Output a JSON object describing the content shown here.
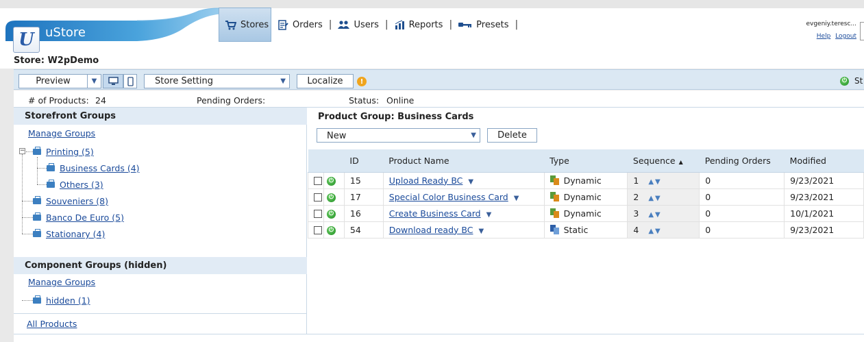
{
  "app": {
    "name": "uStore",
    "logo_letter": "U"
  },
  "nav": [
    {
      "label": "Stores",
      "icon": "cart-icon",
      "active": true
    },
    {
      "label": "Orders",
      "icon": "orders-icon",
      "active": false
    },
    {
      "label": "Users",
      "icon": "users-icon",
      "active": false
    },
    {
      "label": "Reports",
      "icon": "chart-icon",
      "active": false
    },
    {
      "label": "Presets",
      "icon": "key-icon",
      "active": false
    }
  ],
  "user": {
    "name": "evgeniy.teresc...",
    "help": "Help",
    "logout": "Logout"
  },
  "store": {
    "label": "Store: W2pDemo"
  },
  "toolbar": {
    "preview": "Preview",
    "store_setting": "Store Setting",
    "localize": "Localize",
    "status_label": "St"
  },
  "info": {
    "products_label": "# of Products:",
    "products_value": "24",
    "pending_label": "Pending Orders:",
    "pending_value": "",
    "status_label": "Status:",
    "status_value": "Online"
  },
  "storefront_groups": {
    "title": "Storefront Groups",
    "manage": "Manage Groups",
    "items": {
      "printing": "Printing (5)",
      "business_cards": "Business Cards (4)",
      "others": "Others (3)",
      "souveniers": "Souveniers (8)",
      "banco": "Banco De Euro (5)",
      "stationary": "Stationary (4)"
    }
  },
  "component_groups": {
    "title": "Component Groups (hidden)",
    "manage": "Manage Groups",
    "hidden": "hidden (1)"
  },
  "all_products": "All Products",
  "product_group": {
    "title": "Product Group: Business Cards",
    "new_select": "New",
    "delete": "Delete"
  },
  "table": {
    "columns": {
      "id": "ID",
      "name": "Product Name",
      "type": "Type",
      "sequence": "Sequence",
      "pending": "Pending Orders",
      "modified": "Modified"
    },
    "rows": [
      {
        "id": "15",
        "name": "Upload Ready BC",
        "type": "Dynamic",
        "seq": "1",
        "pending": "0",
        "modified": "9/23/2021"
      },
      {
        "id": "17",
        "name": "Special Color Business Card",
        "type": "Dynamic",
        "seq": "2",
        "pending": "0",
        "modified": "9/23/2021"
      },
      {
        "id": "16",
        "name": "Create Business Card",
        "type": "Dynamic",
        "seq": "3",
        "pending": "0",
        "modified": "10/1/2021"
      },
      {
        "id": "54",
        "name": "Download ready BC",
        "type": "Static",
        "seq": "4",
        "pending": "0",
        "modified": "9/23/2021"
      }
    ]
  },
  "colors": {
    "accent": "#2b7bc0",
    "header_bar": "#dbe8f3",
    "link": "#1a4a9a",
    "status_green": "#1d8a1f",
    "warning": "#f0a51e"
  }
}
